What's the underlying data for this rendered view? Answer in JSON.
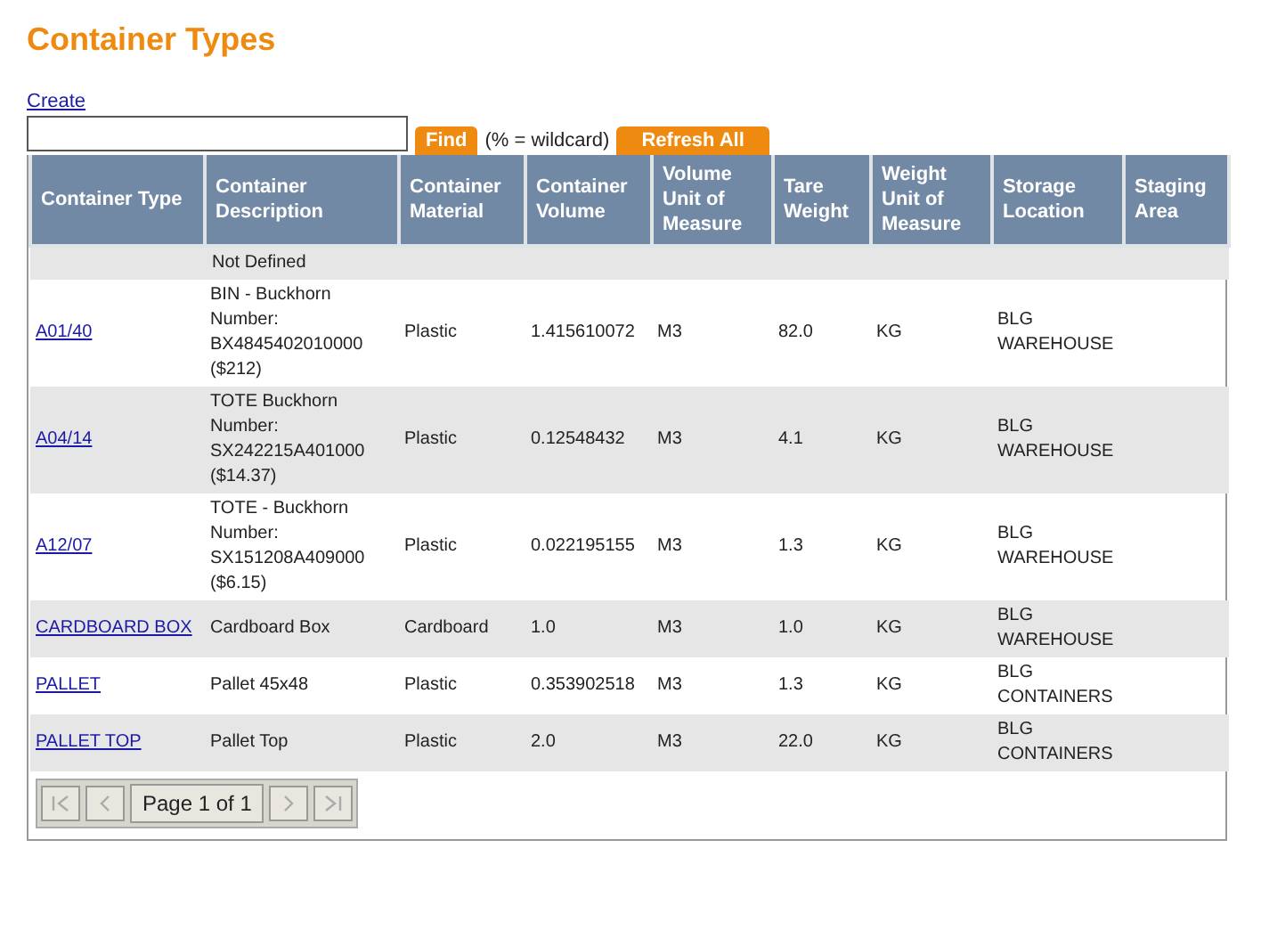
{
  "title": "Container Types",
  "create_link": "Create",
  "find_button": "Find",
  "hint": "(% = wildcard)",
  "refresh_button": "Refresh All",
  "table": {
    "columns": [
      "Container Type",
      "Container Description",
      "Container Material",
      "Container Volume",
      "Volume Unit of Measure",
      "Tare Weight",
      "Weight Unit of Measure",
      "Storage Location",
      "Staging Area"
    ],
    "rows": [
      {
        "cells": [
          "",
          "Not Defined",
          "",
          "",
          "",
          "",
          "",
          "",
          ""
        ]
      },
      {
        "cells": [
          "A01/40",
          "BIN - Buckhorn Number: BX4845402010000 ($212)",
          "Plastic",
          "1.415610072",
          "M3",
          "82.0",
          "KG",
          "BLG WAREHOUSE",
          ""
        ]
      },
      {
        "cells": [
          "A04/14",
          "TOTE Buckhorn Number: SX242215A401000 ($14.37)",
          "Plastic",
          "0.12548432",
          "M3",
          "4.1",
          "KG",
          "BLG WAREHOUSE",
          ""
        ]
      },
      {
        "cells": [
          "A12/07",
          "TOTE - Buckhorn Number: SX151208A409000 ($6.15)",
          "Plastic",
          "0.022195155",
          "M3",
          "1.3",
          "KG",
          "BLG WAREHOUSE",
          ""
        ]
      },
      {
        "cells": [
          "CARDBOARD BOX",
          "Cardboard Box",
          "Cardboard",
          "1.0",
          "M3",
          "1.0",
          "KG",
          "BLG WAREHOUSE",
          ""
        ]
      },
      {
        "cells": [
          "PALLET",
          "Pallet 45x48",
          "Plastic",
          "0.353902518",
          "M3",
          "1.3",
          "KG",
          "BLG CONTAINERS",
          ""
        ]
      },
      {
        "cells": [
          "PALLET TOP",
          "Pallet Top",
          "Plastic",
          "2.0",
          "M3",
          "22.0",
          "KG",
          "BLG CONTAINERS",
          ""
        ]
      }
    ]
  },
  "pager": {
    "label": "Page 1 of 1",
    "first_disabled": true,
    "prev_disabled": true,
    "next_disabled": true,
    "last_disabled": true
  }
}
